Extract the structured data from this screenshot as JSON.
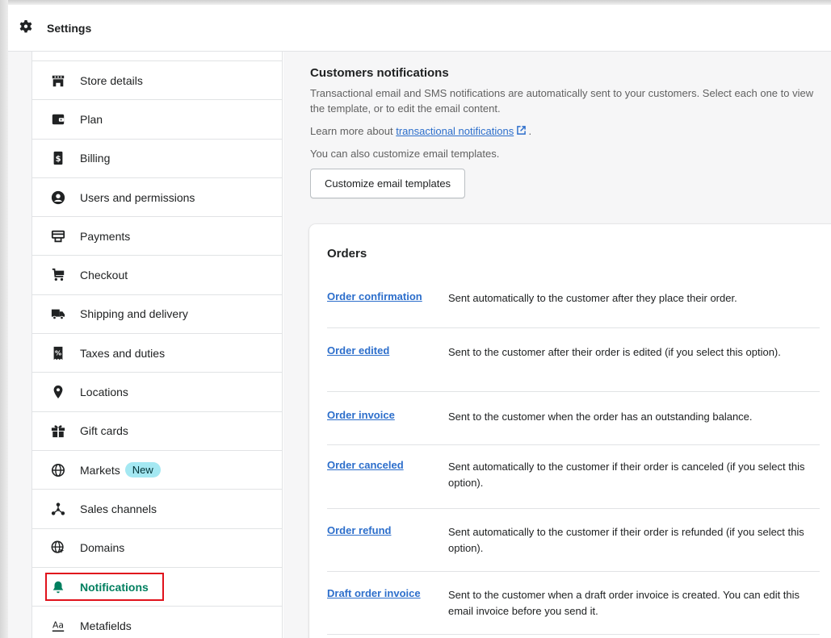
{
  "header": {
    "title": "Settings",
    "icon": "gear-icon"
  },
  "sidebar": {
    "items": [
      {
        "label": "Store details",
        "icon": "store-icon"
      },
      {
        "label": "Plan",
        "icon": "plan-icon"
      },
      {
        "label": "Billing",
        "icon": "billing-icon"
      },
      {
        "label": "Users and permissions",
        "icon": "user-icon"
      },
      {
        "label": "Payments",
        "icon": "payments-icon"
      },
      {
        "label": "Checkout",
        "icon": "cart-icon"
      },
      {
        "label": "Shipping and delivery",
        "icon": "truck-icon"
      },
      {
        "label": "Taxes and duties",
        "icon": "tax-icon"
      },
      {
        "label": "Locations",
        "icon": "location-pin-icon"
      },
      {
        "label": "Gift cards",
        "icon": "gift-icon"
      },
      {
        "label": "Markets",
        "icon": "globe-icon",
        "badge": "New"
      },
      {
        "label": "Sales channels",
        "icon": "channels-icon"
      },
      {
        "label": "Domains",
        "icon": "domains-globe-icon"
      },
      {
        "label": "Notifications",
        "icon": "bell-icon",
        "active": true
      },
      {
        "label": "Metafields",
        "icon": "metafields-icon"
      }
    ]
  },
  "main": {
    "title": "Customers notifications",
    "intro": "Transactional email and SMS notifications are automatically sent to your customers. Select each one to view the template, or to edit the email content.",
    "learn_prefix": "Learn more about ",
    "learn_link": "transactional notifications",
    "learn_suffix": " .",
    "customize_text": "You can also customize email templates.",
    "customize_button": "Customize email templates",
    "card": {
      "title": "Orders",
      "rows": [
        {
          "name": "Order confirmation",
          "desc": "Sent automatically to the customer after they place their order."
        },
        {
          "name": "Order edited",
          "desc": "Sent to the customer after their order is edited (if you select this option)."
        },
        {
          "name": "Order invoice",
          "desc": "Sent to the customer when the order has an outstanding balance."
        },
        {
          "name": "Order canceled",
          "desc": "Sent automatically to the customer if their order is canceled (if you select this option)."
        },
        {
          "name": "Order refund",
          "desc": "Sent automatically to the customer if their order is refunded (if you select this option)."
        },
        {
          "name": "Draft order invoice",
          "desc": "Sent to the customer when a draft order invoice is created. You can edit this email invoice before you send it."
        }
      ]
    }
  },
  "colors": {
    "accent": "#008060",
    "link": "#2c6ecb",
    "badge_bg": "#a4e8f2",
    "highlight": "#e0121c"
  }
}
